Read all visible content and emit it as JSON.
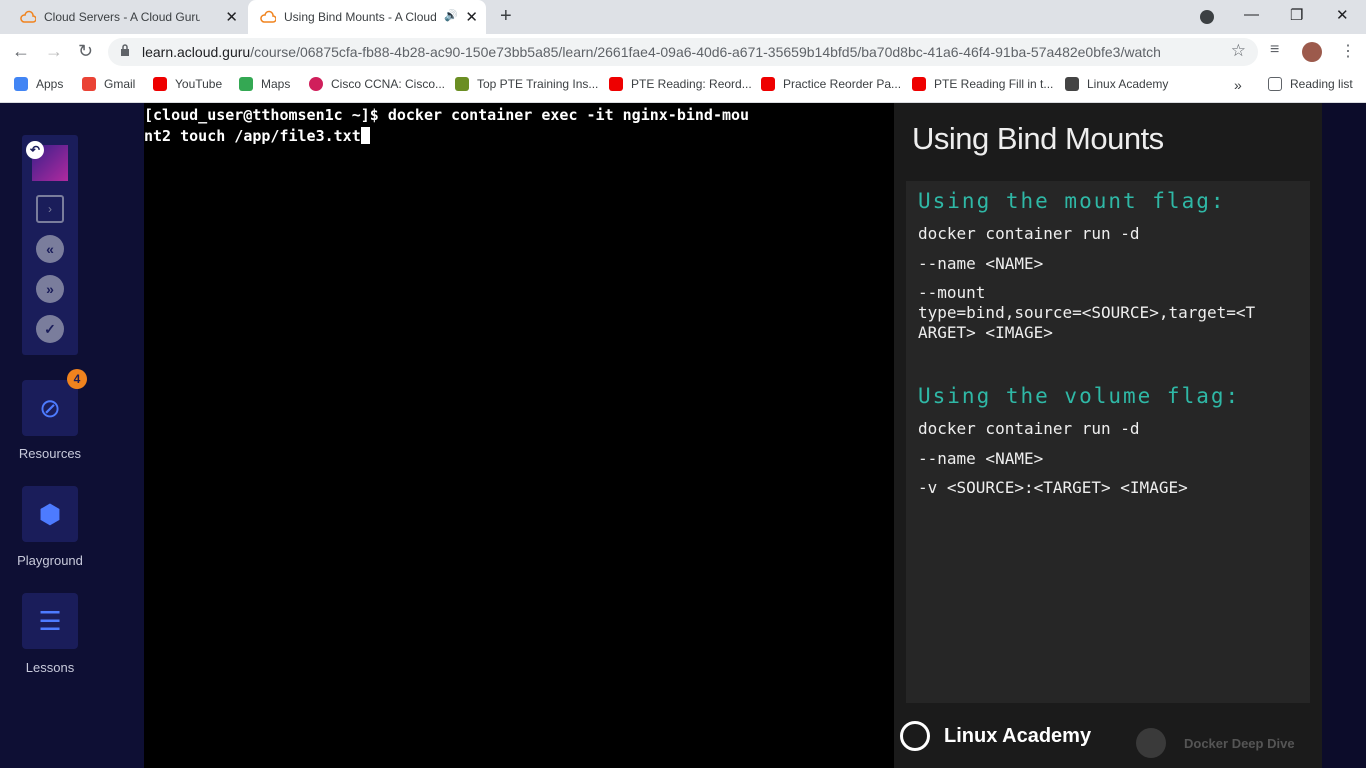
{
  "browser": {
    "tabs": [
      {
        "title": "Cloud Servers - A Cloud Guru",
        "close": "✕"
      },
      {
        "title": "Using Bind Mounts - A Cloud Guru",
        "close": "✕"
      }
    ],
    "new_tab": "+",
    "window_buttons": {
      "minimize": "—",
      "restore": "❐",
      "close": "✕"
    },
    "url_host": "learn.acloud.guru",
    "url_path": "/course/06875cfa-fb88-4b28-ac90-150e73bb5a85/learn/2661fae4-09a6-40d6-a671-35659b14bfd5/ba70d8bc-41a6-46f4-91ba-57a482e0bfe3/watch",
    "bookmarks": [
      {
        "label": "Apps",
        "icon": "apps-grid-icon",
        "color": "#4285f4"
      },
      {
        "label": "Gmail",
        "icon": "gmail-icon",
        "color": "#ea4335"
      },
      {
        "label": "YouTube",
        "icon": "youtube-icon",
        "color": "#ee0000"
      },
      {
        "label": "Maps",
        "icon": "maps-icon",
        "color": "#34a853"
      },
      {
        "label": "Cisco CCNA: Cisco...",
        "icon": "cisco-icon",
        "color": "#d01f5b"
      },
      {
        "label": "Top PTE Training Ins...",
        "icon": "pte-icon",
        "color": "#6b8e23"
      },
      {
        "label": "PTE Reading: Reord...",
        "icon": "youtube-icon",
        "color": "#ee0000"
      },
      {
        "label": "Practice Reorder Pa...",
        "icon": "youtube-icon",
        "color": "#ee0000"
      },
      {
        "label": "PTE Reading Fill in t...",
        "icon": "youtube-icon",
        "color": "#ee0000"
      },
      {
        "label": "Linux Academy",
        "icon": "linux-academy-icon",
        "color": "#444444"
      }
    ],
    "more": "»",
    "reading_list": "Reading list"
  },
  "sidebar": {
    "resources": {
      "label": "Resources",
      "badge": "4"
    },
    "playground": {
      "label": "Playground"
    },
    "lessons": {
      "label": "Lessons"
    }
  },
  "terminal": {
    "line1": "[cloud_user@tthomsen1c ~]$ docker container exec -it nginx-bind-mou",
    "line2": "nt2 touch /app/file3.txt"
  },
  "slide": {
    "title": "Using Bind Mounts",
    "mount_heading": "Using the mount flag:",
    "mount_line1": "docker container run -d",
    "mount_line2": "--name <NAME>",
    "mount_line3a": "--mount",
    "mount_line3b": "type=bind,source=<SOURCE>,target=<T",
    "mount_line3c": "ARGET> <IMAGE>",
    "volume_heading": "Using the volume flag:",
    "volume_line1": "docker container run -d",
    "volume_line2": "--name <NAME>",
    "volume_line3": "-v <SOURCE>:<TARGET> <IMAGE>",
    "footer_brand": "Linux Academy",
    "footer_course": "Docker Deep Dive"
  }
}
